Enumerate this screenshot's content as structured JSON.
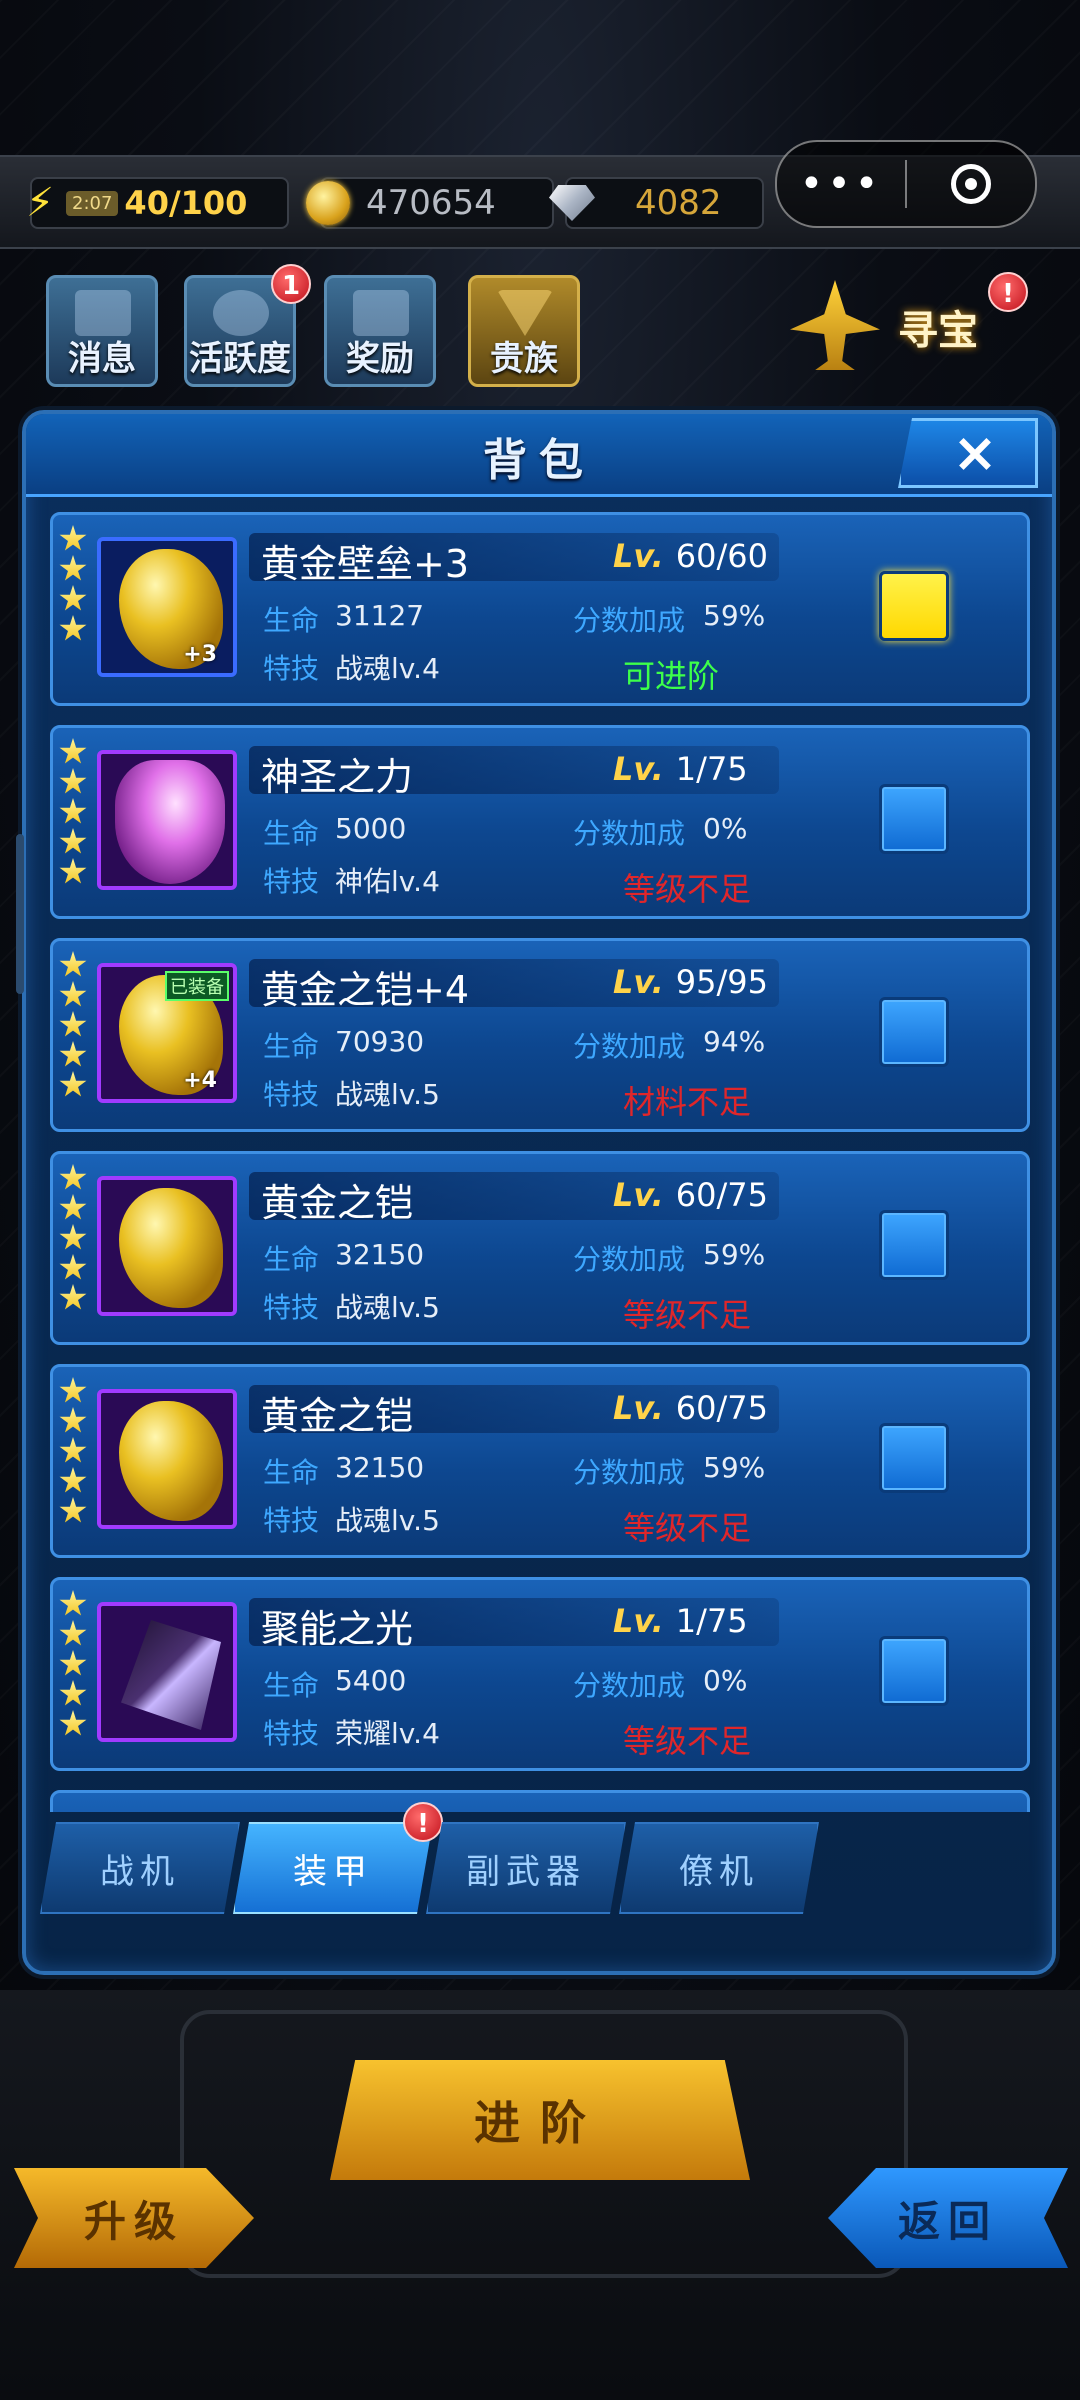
{
  "status": {
    "energy_timer": "2:07",
    "energy": "40/100",
    "gold": "470654",
    "gems": "4082"
  },
  "capsule": {
    "more_icon": "dots-icon",
    "close_icon": "target-icon"
  },
  "menu": {
    "messages": "消息",
    "activity": "活跃度",
    "activity_badge": "1",
    "rewards": "奖励",
    "noble": "贵族",
    "treasure": "寻宝",
    "treasure_badge": "!"
  },
  "panel": {
    "title": "背包",
    "close_icon": "×",
    "labels": {
      "hp": "生命",
      "score_bonus": "分数加成",
      "skill": "特技",
      "lv_prefix": "Lv."
    },
    "items": [
      {
        "name": "黄金壁垒+3",
        "level": "60/60",
        "hp": "31127",
        "bonus": "59%",
        "skill": "战魂lv.4",
        "status": "可进阶",
        "status_type": "ok",
        "selected": true,
        "plus": "+3",
        "stars": 4,
        "quality": "blue",
        "art": "gold"
      },
      {
        "name": "神圣之力",
        "level": "1/75",
        "hp": "5000",
        "bonus": "0%",
        "skill": "神佑lv.4",
        "status": "等级不足",
        "status_type": "bad",
        "selected": false,
        "stars": 5,
        "quality": "purple",
        "art": "pink"
      },
      {
        "name": "黄金之铠+4",
        "level": "95/95",
        "hp": "70930",
        "bonus": "94%",
        "skill": "战魂lv.5",
        "status": "材料不足",
        "status_type": "bad",
        "selected": false,
        "plus": "+4",
        "equipped": "已装备",
        "stars": 5,
        "quality": "purple",
        "art": "gold"
      },
      {
        "name": "黄金之铠",
        "level": "60/75",
        "hp": "32150",
        "bonus": "59%",
        "skill": "战魂lv.5",
        "status": "等级不足",
        "status_type": "bad",
        "selected": false,
        "stars": 5,
        "quality": "purple",
        "art": "gold"
      },
      {
        "name": "黄金之铠",
        "level": "60/75",
        "hp": "32150",
        "bonus": "59%",
        "skill": "战魂lv.5",
        "status": "等级不足",
        "status_type": "bad",
        "selected": false,
        "stars": 5,
        "quality": "purple",
        "art": "gold"
      },
      {
        "name": "聚能之光",
        "level": "1/75",
        "hp": "5400",
        "bonus": "0%",
        "skill": "荣耀lv.4",
        "status": "等级不足",
        "status_type": "bad",
        "selected": false,
        "stars": 5,
        "quality": "purple",
        "art": "crystal"
      }
    ]
  },
  "tabs": [
    {
      "label": "战机",
      "active": false
    },
    {
      "label": "装甲",
      "active": true,
      "badge": "!"
    },
    {
      "label": "副武器",
      "active": false
    },
    {
      "label": "僚机",
      "active": false
    }
  ],
  "buttons": {
    "advance": "进阶",
    "upgrade": "升级",
    "back": "返回"
  },
  "colors": {
    "ok": "#3dff4a",
    "bad": "#e0262a",
    "selected": "#ffe640",
    "panel": "#0a3f83"
  }
}
